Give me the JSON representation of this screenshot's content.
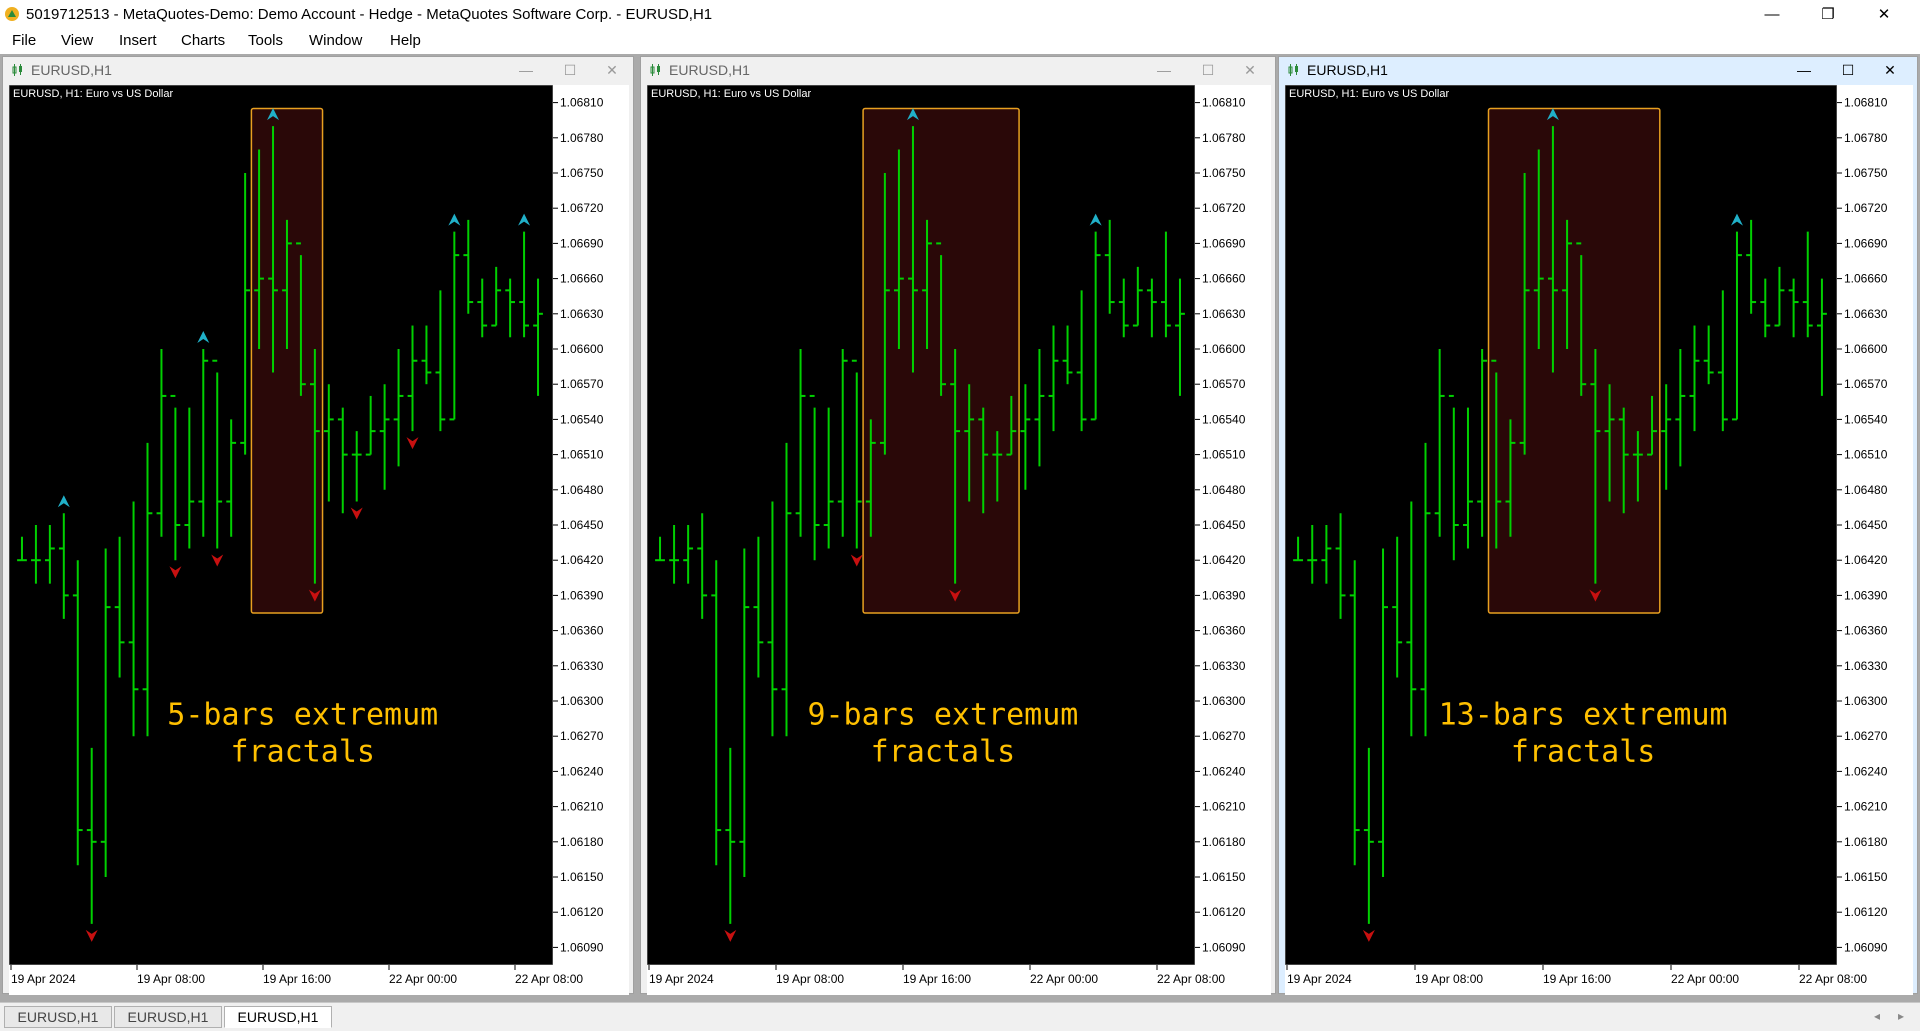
{
  "window": {
    "title": "5019712513 - MetaQuotes-Demo: Demo Account - Hedge - MetaQuotes Software Corp. - EURUSD,H1",
    "minimize": "—",
    "restore": "❐",
    "close": "✕"
  },
  "menu": [
    {
      "label": "File"
    },
    {
      "label": "View"
    },
    {
      "label": "Insert"
    },
    {
      "label": "Charts"
    },
    {
      "label": "Tools"
    },
    {
      "label": "Window"
    },
    {
      "label": "Help"
    }
  ],
  "charts": [
    {
      "title": "EURUSD,H1",
      "header": "EURUSD, H1:  Euro vs US Dollar",
      "annotation_line1": "5-bars extremum",
      "annotation_line2": "fractals",
      "active": false
    },
    {
      "title": "EURUSD,H1",
      "header": "EURUSD, H1:  Euro vs US Dollar",
      "annotation_line1": "9-bars extremum",
      "annotation_line2": "fractals",
      "active": false
    },
    {
      "title": "EURUSD,H1",
      "header": "EURUSD, H1:  Euro vs US Dollar",
      "annotation_line1": "13-bars extremum",
      "annotation_line2": "fractals",
      "active": true
    }
  ],
  "tabs": [
    {
      "label": "EURUSD,H1",
      "active": false
    },
    {
      "label": "EURUSD,H1",
      "active": false
    },
    {
      "label": "EURUSD,H1",
      "active": true
    }
  ],
  "colors": {
    "chart_bg": "#000000",
    "bar": "#00d000",
    "up_fractal": "#20b0c8",
    "down_fractal": "#c81010",
    "highlight_border": "#e8a020",
    "highlight_fill": "#2a0808",
    "annotation_text": "#ffc000"
  },
  "chart_data": {
    "type": "ohlc",
    "symbol": "EURUSD",
    "timeframe": "H1",
    "y_tick_labels": [
      "1.06810",
      "1.06780",
      "1.06750",
      "1.06720",
      "1.06690",
      "1.06660",
      "1.06630",
      "1.06600",
      "1.06570",
      "1.06540",
      "1.06510",
      "1.06480",
      "1.06450",
      "1.06420",
      "1.06390",
      "1.06360",
      "1.06330",
      "1.06300",
      "1.06270",
      "1.06240",
      "1.06210",
      "1.06180",
      "1.06150",
      "1.06120",
      "1.06090"
    ],
    "y_ticks": [
      1.0681,
      1.0678,
      1.0675,
      1.0672,
      1.0669,
      1.0666,
      1.0663,
      1.066,
      1.0657,
      1.0654,
      1.0651,
      1.0648,
      1.0645,
      1.0642,
      1.0639,
      1.0636,
      1.0633,
      1.063,
      1.0627,
      1.0624,
      1.0621,
      1.0618,
      1.0615,
      1.0612,
      1.0609
    ],
    "ylim": [
      1.06075,
      1.06825
    ],
    "x_tick_labels": [
      "19 Apr 2024",
      "19 Apr 08:00",
      "19 Apr 16:00",
      "22 Apr 00:00",
      "22 Apr 08:00"
    ],
    "bars": [
      [
        1.0642,
        1.0644,
        1.0642,
        1.0642
      ],
      [
        1.0642,
        1.0645,
        1.064,
        1.0642
      ],
      [
        1.0642,
        1.0645,
        1.064,
        1.0643
      ],
      [
        1.0643,
        1.0646,
        1.0637,
        1.0639
      ],
      [
        1.0639,
        1.0642,
        1.0616,
        1.0619
      ],
      [
        1.0619,
        1.0626,
        1.0611,
        1.0618
      ],
      [
        1.0618,
        1.0643,
        1.0615,
        1.0638
      ],
      [
        1.0638,
        1.0644,
        1.0632,
        1.0635
      ],
      [
        1.0635,
        1.0647,
        1.0627,
        1.0631
      ],
      [
        1.0631,
        1.0652,
        1.0627,
        1.0646
      ],
      [
        1.0646,
        1.066,
        1.0644,
        1.0656
      ],
      [
        1.0656,
        1.0655,
        1.0642,
        1.0645
      ],
      [
        1.0645,
        1.0655,
        1.0643,
        1.0647
      ],
      [
        1.0647,
        1.066,
        1.0644,
        1.0659
      ],
      [
        1.0659,
        1.0658,
        1.0643,
        1.0647
      ],
      [
        1.0647,
        1.0654,
        1.0644,
        1.0652
      ],
      [
        1.0652,
        1.0675,
        1.0651,
        1.0665
      ],
      [
        1.0665,
        1.0677,
        1.066,
        1.0666
      ],
      [
        1.0666,
        1.0679,
        1.0658,
        1.0665
      ],
      [
        1.0665,
        1.0671,
        1.066,
        1.0669
      ],
      [
        1.0669,
        1.0668,
        1.0656,
        1.0657
      ],
      [
        1.0657,
        1.066,
        1.064,
        1.0653
      ],
      [
        1.0653,
        1.0657,
        1.0647,
        1.0654
      ],
      [
        1.0654,
        1.0655,
        1.0646,
        1.0651
      ],
      [
        1.0651,
        1.0653,
        1.0647,
        1.0651
      ],
      [
        1.0651,
        1.0656,
        1.0651,
        1.0653
      ],
      [
        1.0653,
        1.0657,
        1.0648,
        1.0654
      ],
      [
        1.0654,
        1.066,
        1.065,
        1.0656
      ],
      [
        1.0656,
        1.0662,
        1.0653,
        1.0659
      ],
      [
        1.0659,
        1.0662,
        1.0657,
        1.0658
      ],
      [
        1.0658,
        1.0665,
        1.0653,
        1.0654
      ],
      [
        1.0654,
        1.067,
        1.0654,
        1.0668
      ],
      [
        1.0668,
        1.0671,
        1.0663,
        1.0664
      ],
      [
        1.0664,
        1.0666,
        1.0661,
        1.0662
      ],
      [
        1.0662,
        1.0667,
        1.0662,
        1.0665
      ],
      [
        1.0665,
        1.0666,
        1.0661,
        1.0664
      ],
      [
        1.0664,
        1.067,
        1.0661,
        1.0662
      ],
      [
        1.0662,
        1.0666,
        1.0656,
        1.0663
      ]
    ],
    "fractals": [
      {
        "period": 5,
        "up": [
          3,
          13,
          18,
          31,
          36
        ],
        "down": [
          5,
          11,
          14,
          21,
          24,
          28
        ],
        "highlight": [
          17,
          21
        ]
      },
      {
        "period": 9,
        "up": [
          18,
          31
        ],
        "down": [
          5,
          14,
          21
        ],
        "highlight": [
          15,
          25
        ]
      },
      {
        "period": 13,
        "up": [
          18,
          31
        ],
        "down": [
          5,
          21
        ],
        "highlight": [
          14,
          25
        ]
      }
    ]
  }
}
